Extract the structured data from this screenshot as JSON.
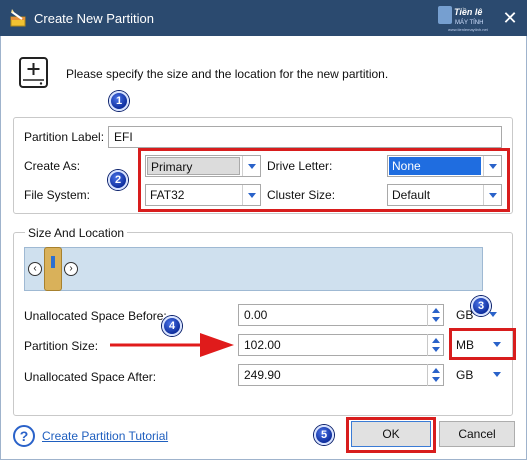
{
  "window": {
    "title": "Create New Partition",
    "close_glyph": "✕",
    "app_icon": "wand-partition-icon"
  },
  "watermark": {
    "line1": "Tiền lê",
    "line2": "MÁY TÍNH",
    "line3": "www.tienlemaytinh.net"
  },
  "intro": {
    "text": "Please specify the size and the location for the new partition.",
    "icon": "drive-add-icon"
  },
  "markers": [
    "1",
    "2",
    "3",
    "4",
    "5"
  ],
  "form": {
    "partition_label": {
      "label": "Partition Label:",
      "value": "EFI"
    },
    "create_as": {
      "label": "Create As:",
      "value": "Primary"
    },
    "drive_letter": {
      "label": "Drive Letter:",
      "value": "None"
    },
    "file_system": {
      "label": "File System:",
      "value": "FAT32"
    },
    "cluster_size": {
      "label": "Cluster Size:",
      "value": "Default"
    }
  },
  "size_location": {
    "legend": "Size And Location",
    "left_nav": "‹",
    "right_nav": "›",
    "slider_position": 0.05,
    "unallocated_before": {
      "label": "Unallocated Space Before:",
      "value": "0.00",
      "unit": "GB"
    },
    "partition_size": {
      "label": "Partition Size:",
      "value": "102.00",
      "unit": "MB"
    },
    "unallocated_after": {
      "label": "Unallocated Space After:",
      "value": "249.90",
      "unit": "GB"
    }
  },
  "footer": {
    "help_glyph": "?",
    "tutorial_link": "Create Partition Tutorial",
    "ok_label": "OK",
    "cancel_label": "Cancel"
  },
  "colors": {
    "titlebar": "#2b4a6f",
    "highlight": "#d81d1d",
    "accent": "#2a62c9",
    "marker": "#1e3fbf"
  }
}
